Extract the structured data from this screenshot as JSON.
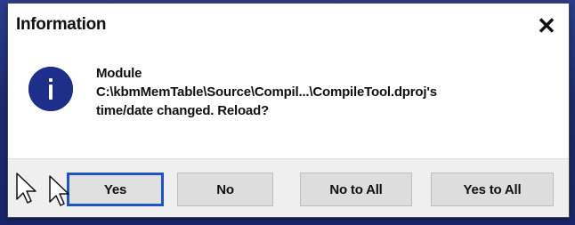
{
  "dialog": {
    "title": "Information",
    "close_icon": "close-icon",
    "icon": "information-icon",
    "message": {
      "line1": "Module",
      "line2": "C:\\kbmMemTable\\Source\\Compil...\\CompileTool.dproj's",
      "line3": "time/date changed. Reload?"
    },
    "buttons": {
      "yes": "Yes",
      "no": "No",
      "no_to_all": "No to All",
      "yes_to_all": "Yes to All"
    }
  },
  "colors": {
    "backdrop": "#1f2f7a",
    "info_icon": "#1d2f8a",
    "default_button_border": "#1d55c9",
    "button_face": "#dddddd"
  }
}
